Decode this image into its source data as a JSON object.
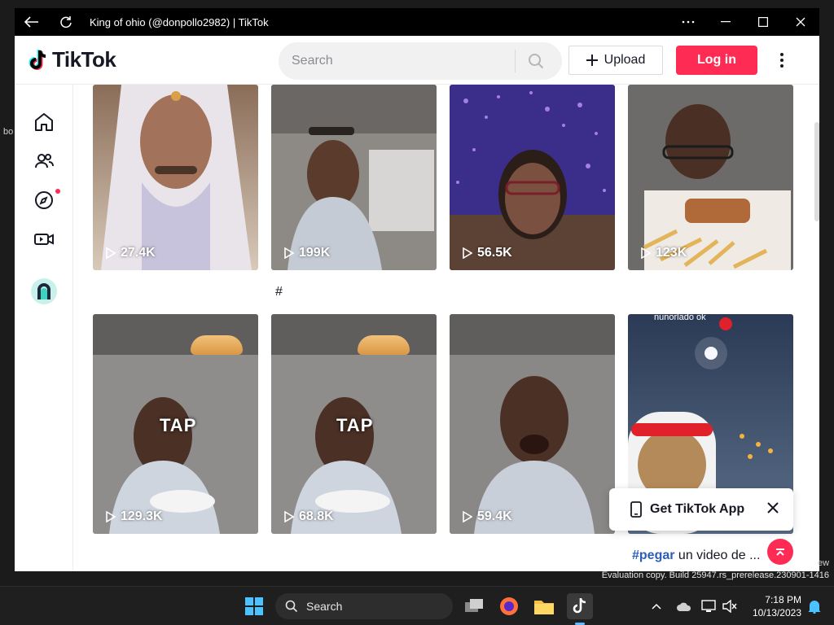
{
  "window": {
    "title": "King of ohio (@donpollo2982) | TikTok"
  },
  "header": {
    "logo_text": "TikTok",
    "search_placeholder": "Search",
    "upload_label": "Upload",
    "login_label": "Log in"
  },
  "sidebar": {
    "items": [
      {
        "icon": "home-icon"
      },
      {
        "icon": "following-icon"
      },
      {
        "icon": "explore-icon",
        "badge": true
      },
      {
        "icon": "live-icon"
      },
      {
        "icon": "profile-avatar"
      }
    ]
  },
  "videos": [
    {
      "views": "27.4K"
    },
    {
      "views": "199K",
      "caption": "#"
    },
    {
      "views": "56.5K"
    },
    {
      "views": "123K"
    },
    {
      "views": "129.3K",
      "overlay": "TAP"
    },
    {
      "views": "68.8K",
      "overlay": "TAP"
    },
    {
      "views": "59.4K"
    },
    {
      "views": "",
      "overlay_text": "nunorlado ok",
      "caption_tag": "#pegar",
      "caption_rest": " un video de ..."
    }
  ],
  "app_banner": {
    "label": "Get TikTok App"
  },
  "desktop": {
    "left_text": "bo",
    "right_text": "ew",
    "eval_text": "Evaluation copy. Build 25947.rs_prerelease.230901-1416"
  },
  "taskbar": {
    "search_label": "Search",
    "time": "7:18 PM",
    "date": "10/13/2023"
  },
  "colors": {
    "brand_red": "#fe2c55",
    "hashtag_blue": "#2b5db9",
    "text_dark": "#161823"
  }
}
